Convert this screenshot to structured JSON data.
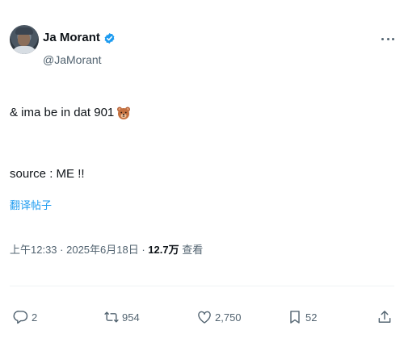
{
  "author": {
    "display_name": "Ja Morant",
    "handle": "@JaMorant",
    "verified": true
  },
  "tweet": {
    "line1": "& ima be in dat 901",
    "line1_emoji": "bear-face-icon",
    "line2": "source : ME !!"
  },
  "translate_link": "翻译帖子",
  "meta": {
    "time": "上午12:33",
    "separator": " · ",
    "date": "2025年6月18日",
    "views_count": "12.7万",
    "views_label": "查看"
  },
  "actions": {
    "replies": "2",
    "reposts": "954",
    "likes": "2,750",
    "bookmarks": "52"
  },
  "colors": {
    "verified_blue": "#1d9bf0",
    "secondary_text": "#536471",
    "link": "#1d9bf0"
  }
}
